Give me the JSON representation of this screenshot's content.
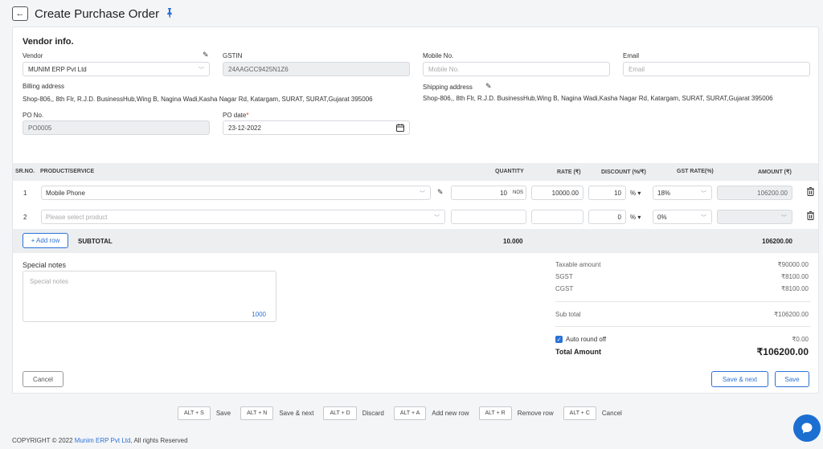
{
  "header": {
    "title": "Create Purchase Order",
    "back_icon": "←",
    "pin_icon": "📌"
  },
  "vendor": {
    "section_title": "Vendor info.",
    "vendor_label": "Vendor",
    "vendor_value": "MUNIM ERP Pvt Ltd",
    "gstin_label": "GSTIN",
    "gstin_value": "24AAGCC9425N1Z6",
    "mobile_label": "Mobile No.",
    "mobile_placeholder": "Mobile No.",
    "email_label": "Email",
    "email_placeholder": "Email",
    "billing_label": "Billing address",
    "billing_value": "Shop-806,, 8th Flr, R.J.D. BusinessHub,Wing B, Nagina Wadi,Kasha Nagar Rd, Katargam, SURAT, SURAT,Gujarat 395006",
    "shipping_label": "Shipping address",
    "shipping_value": "Shop-806,, 8th Flr, R.J.D. BusinessHub,Wing B, Nagina Wadi,Kasha Nagar Rd, Katargam, SURAT, SURAT,Gujarat 395006",
    "po_no_label": "PO No.",
    "po_no_value": "PO0005",
    "po_date_label": "PO date",
    "po_date_required": "*",
    "po_date_value": "23-12-2022"
  },
  "table": {
    "headers": [
      "SR.NO.",
      "PRODUCT/SERVICE",
      "QUANTITY",
      "RATE (₹)",
      "DISCOUNT (%/₹)",
      "GST RATE(%)",
      "AMOUNT (₹)"
    ],
    "rows": [
      {
        "sr": "1",
        "product": "Mobile Phone",
        "quantity": "10",
        "unit": "NOS",
        "rate": "10000.00",
        "discount": "10",
        "discount_type": "%",
        "gst": "18%",
        "amount": "106200.00"
      },
      {
        "sr": "2",
        "product_placeholder": "Please select product",
        "quantity": "",
        "rate": "",
        "discount": "0",
        "discount_type": "%",
        "gst": "0%",
        "amount": ""
      }
    ],
    "add_row_label": "+ Add row",
    "subtotal_label": "SUBTOTAL",
    "subtotal_quantity": "10.000",
    "subtotal_amount": "106200.00"
  },
  "notes": {
    "label": "Special notes",
    "placeholder": "Special notes",
    "char_count": "1000"
  },
  "summary": {
    "taxable_label": "Taxable amount",
    "taxable_value": "₹90000.00",
    "sgst_label": "SGST",
    "sgst_value": "₹8100.00",
    "cgst_label": "CGST",
    "cgst_value": "₹8100.00",
    "subtotal_label": "Sub total",
    "subtotal_value": "₹106200.00",
    "round_off_label": "Auto round off",
    "round_off_value": "₹0.00",
    "total_label": "Total Amount",
    "total_value": "₹106200.00"
  },
  "actions": {
    "cancel": "Cancel",
    "save_next": "Save & next",
    "save": "Save"
  },
  "shortcuts": [
    {
      "key": "ALT + S",
      "label": "Save"
    },
    {
      "key": "ALT + N",
      "label": "Save & next"
    },
    {
      "key": "ALT + D",
      "label": "Discard"
    },
    {
      "key": "ALT + A",
      "label": "Add new row"
    },
    {
      "key": "ALT + R",
      "label": "Remove row"
    },
    {
      "key": "ALT + C",
      "label": "Cancel"
    }
  ],
  "footer": {
    "prefix": "COPYRIGHT © 2022 ",
    "company": "Munim ERP Pvt Ltd",
    "suffix": ", All rights Reserved"
  },
  "colors": {
    "accent": "#2b72d6",
    "chat": "#1b6fd1"
  }
}
